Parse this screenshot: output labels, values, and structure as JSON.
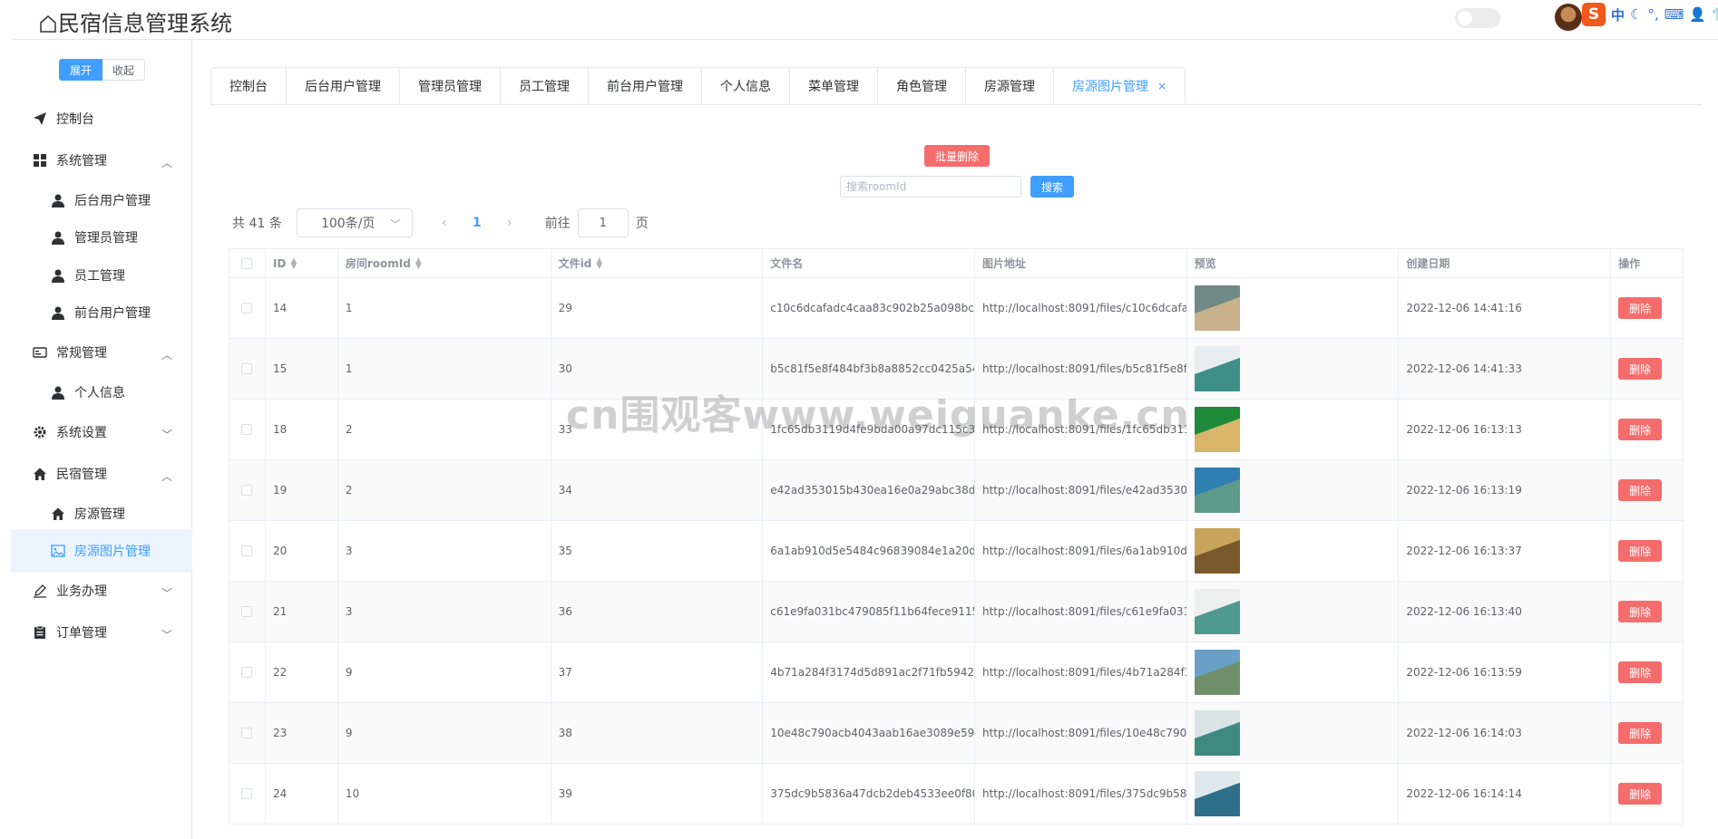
{
  "header": {
    "title": "民宿信息管理系统",
    "ime": {
      "logo": "S",
      "mode": "中",
      "icons": [
        "moon-icon",
        "punctuation-icon",
        "keyboard-icon",
        "user-icon",
        "shirt-icon"
      ]
    }
  },
  "sidebar": {
    "expand_label": "展开",
    "collapse_label": "收起",
    "items": [
      {
        "label": "控制台",
        "icon": "send-icon",
        "level": "top"
      },
      {
        "label": "系统管理",
        "icon": "grid-icon",
        "level": "top",
        "arrow": "up"
      },
      {
        "label": "后台用户管理",
        "icon": "person-icon",
        "level": "sub"
      },
      {
        "label": "管理员管理",
        "icon": "person-icon",
        "level": "sub"
      },
      {
        "label": "员工管理",
        "icon": "person-icon",
        "level": "sub"
      },
      {
        "label": "前台用户管理",
        "icon": "person-icon",
        "level": "sub"
      },
      {
        "label": "常规管理",
        "icon": "card-icon",
        "level": "top",
        "arrow": "up"
      },
      {
        "label": "个人信息",
        "icon": "person-icon",
        "level": "sub"
      },
      {
        "label": "系统设置",
        "icon": "gear-icon",
        "level": "top",
        "arrow": "down"
      },
      {
        "label": "民宿管理",
        "icon": "house-icon",
        "level": "top",
        "arrow": "up"
      },
      {
        "label": "房源管理",
        "icon": "house-icon",
        "level": "sub"
      },
      {
        "label": "房源图片管理",
        "icon": "picture-icon",
        "level": "sub",
        "selected": true
      },
      {
        "label": "业务办理",
        "icon": "pen-icon",
        "level": "top",
        "arrow": "down"
      },
      {
        "label": "订单管理",
        "icon": "clipboard-icon",
        "level": "top",
        "arrow": "down"
      }
    ]
  },
  "tabs": [
    {
      "label": "控制台"
    },
    {
      "label": "后台用户管理"
    },
    {
      "label": "管理员管理"
    },
    {
      "label": "员工管理"
    },
    {
      "label": "前台用户管理"
    },
    {
      "label": "个人信息"
    },
    {
      "label": "菜单管理"
    },
    {
      "label": "角色管理"
    },
    {
      "label": "房源管理"
    },
    {
      "label": "房源图片管理",
      "active": true,
      "close": "×"
    }
  ],
  "toolbar": {
    "batch_delete_label": "批量删除",
    "search_placeholder": "搜索roomId",
    "search_label": "搜索"
  },
  "pager": {
    "total_text": "共 41 条",
    "page_size": "100条/页",
    "current_page": "1",
    "goto_prefix": "前往",
    "goto_value": "1",
    "goto_suffix": "页"
  },
  "table": {
    "columns": [
      "ID",
      "房间roomId",
      "文件id",
      "文件名",
      "图片地址",
      "预览",
      "创建日期",
      "操作"
    ],
    "delete_label": "删除",
    "rows": [
      {
        "id": "14",
        "room": "1",
        "file_id": "29",
        "name": "c10c6dcafadc4caa83c902b25a098bc...",
        "url": "http://localhost:8091/files/c10c6dcafad...",
        "date": "2022-12-06 14:41:16",
        "thumb": [
          "#6f8a86",
          "#c9b28b"
        ]
      },
      {
        "id": "15",
        "room": "1",
        "file_id": "30",
        "name": "b5c81f5e8f484bf3b8a8852cc0425a54...",
        "url": "http://localhost:8091/files/b5c81f5e8f4...",
        "date": "2022-12-06 14:41:33",
        "thumb": [
          "#e8eef0",
          "#3f8f88"
        ]
      },
      {
        "id": "18",
        "room": "2",
        "file_id": "33",
        "name": "1fc65db3119d4fe9bda00a97dc115c3c...",
        "url": "http://localhost:8091/files/1fc65db3119...",
        "date": "2022-12-06 16:13:13",
        "thumb": [
          "#1e8a3a",
          "#d9b56a"
        ]
      },
      {
        "id": "19",
        "room": "2",
        "file_id": "34",
        "name": "e42ad353015b430ea16e0a29abc38d...",
        "url": "http://localhost:8091/files/e42ad35301...",
        "date": "2022-12-06 16:13:19",
        "thumb": [
          "#2f7fb0",
          "#5e9a8a"
        ]
      },
      {
        "id": "20",
        "room": "3",
        "file_id": "35",
        "name": "6a1ab910d5e5484c96839084e1a20d...",
        "url": "http://localhost:8091/files/6a1ab910d5...",
        "date": "2022-12-06 16:13:37",
        "thumb": [
          "#c9a45c",
          "#7a5a2c"
        ]
      },
      {
        "id": "21",
        "room": "3",
        "file_id": "36",
        "name": "c61e9fa031bc479085f11b64fece9115...",
        "url": "http://localhost:8091/files/c61e9fa031...",
        "date": "2022-12-06 16:13:40",
        "thumb": [
          "#eef0f0",
          "#4f9a8e"
        ]
      },
      {
        "id": "22",
        "room": "9",
        "file_id": "37",
        "name": "4b71a284f3174d5d891ac2f71fb59423...",
        "url": "http://localhost:8091/files/4b71a284f3...",
        "date": "2022-12-06 16:13:59",
        "thumb": [
          "#6aa0c8",
          "#6f8f6a"
        ]
      },
      {
        "id": "23",
        "room": "9",
        "file_id": "38",
        "name": "10e48c790acb4043aab16ae3089e59...",
        "url": "http://localhost:8091/files/10e48c790a...",
        "date": "2022-12-06 16:14:03",
        "thumb": [
          "#d8e4e6",
          "#3f8a80"
        ]
      },
      {
        "id": "24",
        "room": "10",
        "file_id": "39",
        "name": "375dc9b5836a47dcb2deb4533ee0f80...",
        "url": "http://localhost:8091/files/375dc9b583...",
        "date": "2022-12-06 16:14:14",
        "thumb": [
          "#dfe8ec",
          "#2f6f8a"
        ]
      }
    ]
  },
  "watermark": "cn围观客www.weiguanke.cn",
  "colors": {
    "primary": "#409eff",
    "danger": "#f56c6c",
    "selected_bg": "#ecf5ff"
  }
}
